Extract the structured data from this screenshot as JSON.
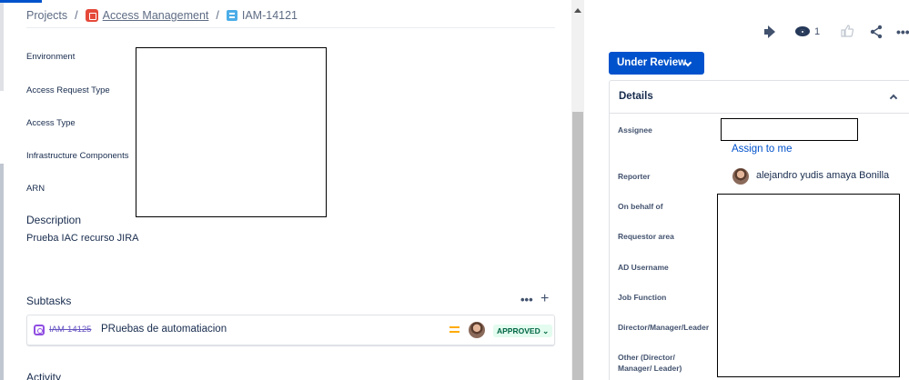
{
  "breadcrumb": {
    "projects": "Projects",
    "separator": "/",
    "project_name": "Access Management",
    "issue_key": "IAM-14121"
  },
  "fields": {
    "environment": "Environment",
    "access_request_type": "Access Request Type",
    "access_type": "Access Type",
    "infrastructure_components": "Infrastructure Components",
    "arn": "ARN"
  },
  "description": {
    "title": "Description",
    "text": "Prueba IAC recurso JIRA"
  },
  "subtasks": {
    "title": "Subtasks",
    "more": "•••",
    "add": "+",
    "items": [
      {
        "key": "IAM-14125",
        "summary": "PRuebas de automatiacion",
        "priority": "medium",
        "status": "APPROVED"
      }
    ]
  },
  "activity": {
    "title": "Activity"
  },
  "toolbar": {
    "watch_count": "1",
    "more": "•••"
  },
  "status_button": {
    "label": "Under Review"
  },
  "details": {
    "title": "Details",
    "assignee_label": "Assignee",
    "assign_to_me": "Assign to me",
    "reporter_label": "Reporter",
    "reporter_name": "alejandro yudis amaya Bonilla",
    "on_behalf_of_label": "On behalf of",
    "requestor_area_label": "Requestor area",
    "ad_username_label": "AD Username",
    "job_function_label": "Job Function",
    "director_label": "Director/Manager/Leader",
    "other_director_label_line1": "Other (Director/",
    "other_director_label_line2": "Manager/ Leader)"
  },
  "colors": {
    "brand_blue": "#0052cc",
    "approved_bg": "#e3fcef",
    "approved_text": "#006644",
    "priority_medium": "#ffab00",
    "subtask_purple": "#904ee2"
  }
}
